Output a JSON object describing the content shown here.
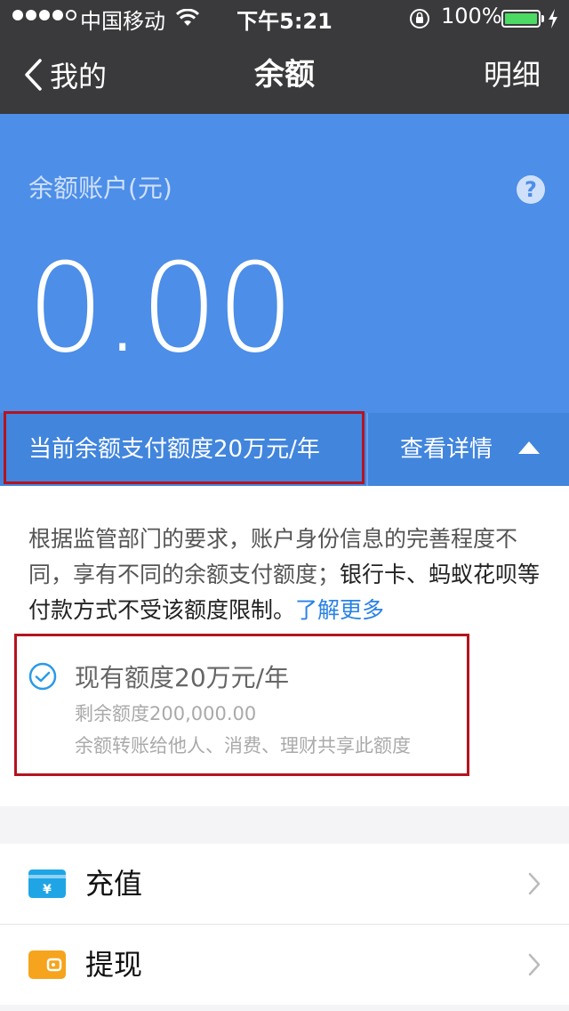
{
  "status_bar": {
    "carrier": "中国移动",
    "time": "下午5:21",
    "battery": "100%",
    "signal_bars_filled": 4,
    "signal_bars_total": 5
  },
  "nav": {
    "back_label": "我的",
    "title": "余额",
    "detail_label": "明细"
  },
  "balance": {
    "label": "余额账户(元)",
    "help_symbol": "?",
    "amount": "0.00"
  },
  "quota_bar": {
    "current_quota": "当前余额支付额度20万元/年",
    "view_details": "查看详情"
  },
  "info": {
    "text_part1": "根据监管部门的要求，账户身份信息的完善程度不同，享有不同的余额支付额度；",
    "text_part2": "银行卡、蚂蚁花呗等付款方式不受该额度限制。",
    "learn_more": "了解更多"
  },
  "limit": {
    "title": "现有额度20万元/年",
    "remaining": "剩余额度200,000.00",
    "note": "余额转账给他人、消费、理财共享此额度"
  },
  "menu": [
    {
      "label": "充值",
      "icon": "yen-card-icon",
      "color": "#1fa5e6"
    },
    {
      "label": "提现",
      "icon": "wallet-icon",
      "color": "#f6a41d"
    }
  ],
  "colors": {
    "nav_bg": "#3a3a3c",
    "hero_bg": "#4c8ee8",
    "quota_bg": "#4185dd",
    "link": "#2a82e4",
    "highlight_border": "#b4141e"
  }
}
